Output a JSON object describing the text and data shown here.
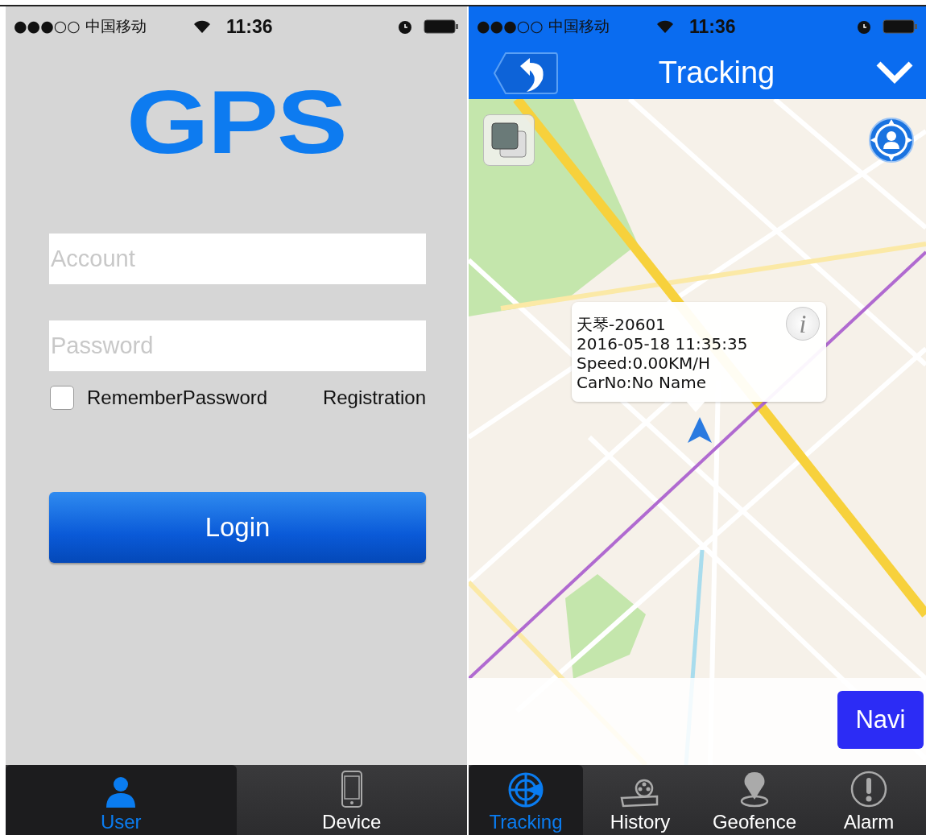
{
  "login_screen": {
    "status_bar": {
      "carrier": "●●●○○ 中国移动",
      "time": "11:36"
    },
    "logo": "GPS",
    "fields": [
      {
        "placeholder": "Account"
      },
      {
        "placeholder": "Password"
      }
    ],
    "remember": {
      "label": "RememberPassword",
      "checked": false
    },
    "registration_link": "Registration",
    "login_button": "Login",
    "tabs": [
      {
        "label": "User",
        "selected": true
      },
      {
        "label": "Device",
        "selected": false
      }
    ]
  },
  "tracking_screen": {
    "status_bar": {
      "carrier": "●●●○○ 中国移动",
      "time": "11:36"
    },
    "title": "Tracking",
    "callout": {
      "lines": [
        "天琴-20601",
        "2016-05-18 11:35:35",
        "Speed:0.00KM/H",
        "CarNo:No Name"
      ],
      "info_button": "i"
    },
    "navi_button": "Navi",
    "tabs": [
      {
        "label": "Tracking",
        "selected": true
      },
      {
        "label": "History",
        "selected": false
      },
      {
        "label": "Geofence",
        "selected": false
      },
      {
        "label": "Alarm",
        "selected": false
      }
    ]
  }
}
